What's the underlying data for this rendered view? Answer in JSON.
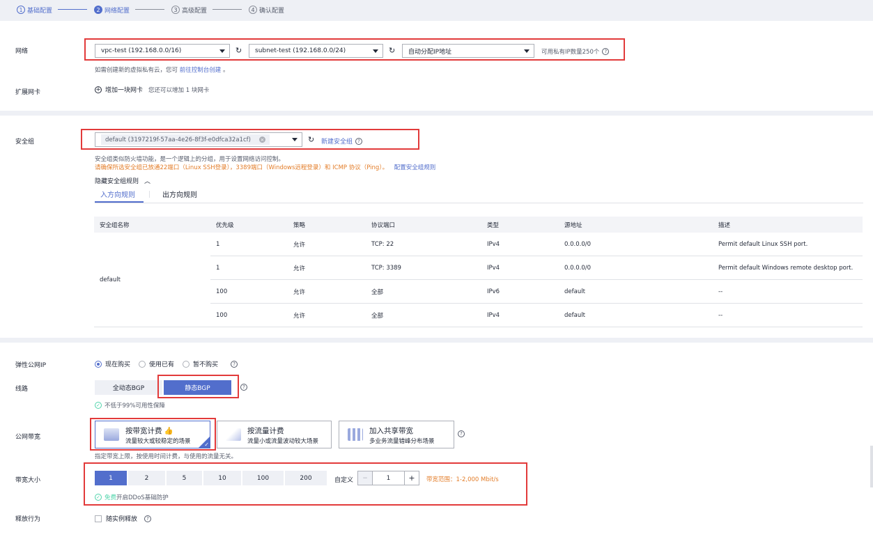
{
  "steps": [
    {
      "num": "1",
      "label": "基础配置"
    },
    {
      "num": "2",
      "label": "网络配置"
    },
    {
      "num": "3",
      "label": "高级配置"
    },
    {
      "num": "4",
      "label": "确认配置"
    }
  ],
  "network": {
    "label": "网络",
    "vpc": "vpc-test (192.168.0.0/16)",
    "subnet": "subnet-test (192.168.0.0/24)",
    "ip_mode": "自动分配IP地址",
    "available": "可用私有IP数量250个",
    "hint_prefix": "如需创建新的虚拟私有云，您可",
    "hint_link": "前往控制台创建",
    "hint_suffix": "。"
  },
  "ext_nic": {
    "label": "扩展网卡",
    "add": "增加一块网卡",
    "hint": "您还可以增加 1 块网卡"
  },
  "security": {
    "label": "安全组",
    "tag": "default (3197219f-57aa-4e26-8f3f-e0dfca32a1cf)",
    "new_link": "新建安全组",
    "desc": "安全组类似防火墙功能，是一个逻辑上的分组，用于设置网络访问控制。",
    "warn": "请确保所选安全组已放通22端口（Linux SSH登录），3389端口（Windows远程登录）和 ICMP 协议（Ping）。",
    "config_link": "配置安全组规则",
    "hide": "隐藏安全组规则",
    "tab_in": "入方向规则",
    "tab_out": "出方向规则",
    "columns": [
      "安全组名称",
      "优先级",
      "策略",
      "协议端口",
      "类型",
      "源地址",
      "描述"
    ],
    "group_name": "default",
    "rows": [
      {
        "priority": "1",
        "policy": "允许",
        "port": "TCP: 22",
        "type": "IPv4",
        "source": "0.0.0.0/0",
        "desc": "Permit default Linux SSH port."
      },
      {
        "priority": "1",
        "policy": "允许",
        "port": "TCP: 3389",
        "type": "IPv4",
        "source": "0.0.0.0/0",
        "desc": "Permit default Windows remote desktop port."
      },
      {
        "priority": "100",
        "policy": "允许",
        "port": "全部",
        "type": "IPv6",
        "source": "default",
        "desc": "--"
      },
      {
        "priority": "100",
        "policy": "允许",
        "port": "全部",
        "type": "IPv4",
        "source": "default",
        "desc": "--"
      }
    ]
  },
  "eip": {
    "label": "弹性公网IP",
    "options": [
      "现在购买",
      "使用已有",
      "暂不购买"
    ]
  },
  "line": {
    "label": "线路",
    "opt1": "全动态BGP",
    "opt2": "静态BGP",
    "guarantee": "不低于99%可用性保障"
  },
  "bandwidth_type": {
    "label": "公网带宽",
    "cards": [
      {
        "title": "按带宽计费",
        "desc": "流量较大或较稳定的场景"
      },
      {
        "title": "按流量计费",
        "desc": "流量小或流量波动较大场景"
      },
      {
        "title": "加入共享带宽",
        "desc": "多业务流量错峰分布场景"
      }
    ],
    "hint": "指定带宽上限，按使用时间计费，与使用的流量无关。"
  },
  "bandwidth_size": {
    "label": "带宽大小",
    "options": [
      "1",
      "2",
      "5",
      "10",
      "100",
      "200"
    ],
    "custom_label": "自定义",
    "value": "1",
    "range": "带宽范围：1-2,000 Mbit/s",
    "ddos_free": "免费",
    "ddos_rest": "开启DDoS基础防护"
  },
  "release": {
    "label": "释放行为",
    "option": "随实例释放"
  },
  "colors": {
    "accent": "#526ecc",
    "red_box": "#e23a3a",
    "warn": "#e37d29",
    "ok": "#50d4ab"
  }
}
